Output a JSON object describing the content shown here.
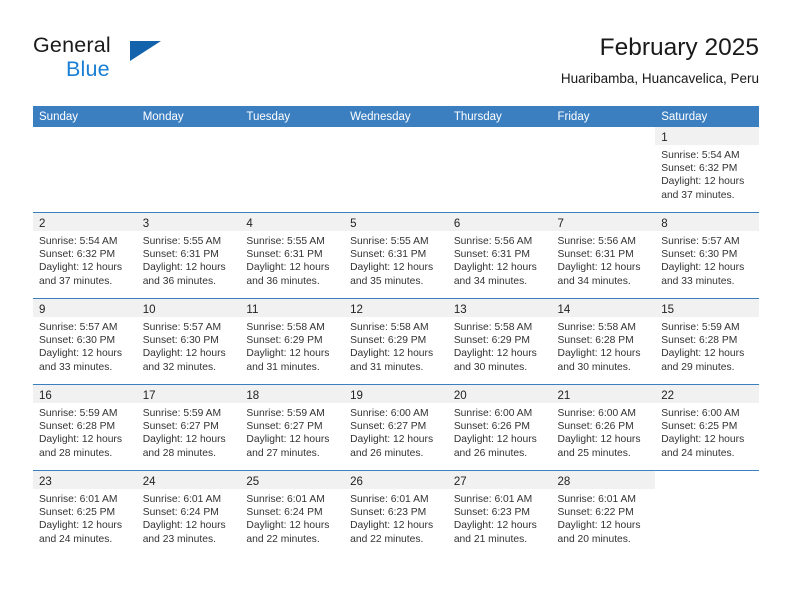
{
  "brand": {
    "line1": "General",
    "line2": "Blue",
    "triangle_color": "#1263ac",
    "blue_color": "#1a7fd4"
  },
  "header": {
    "title": "February 2025",
    "location": "Huaribamba, Huancavelica, Peru"
  },
  "theme": {
    "header_blue": "#3c7fc1",
    "date_band_gray": "#f1f1f1"
  },
  "calendar": {
    "weekday_headers": [
      "Sunday",
      "Monday",
      "Tuesday",
      "Wednesday",
      "Thursday",
      "Friday",
      "Saturday"
    ],
    "labels": {
      "sunrise": "Sunrise:",
      "sunset": "Sunset:",
      "daylight": "Daylight:"
    },
    "weeks": [
      [
        {
          "empty": true
        },
        {
          "empty": true
        },
        {
          "empty": true
        },
        {
          "empty": true
        },
        {
          "empty": true
        },
        {
          "empty": true
        },
        {
          "day": "1",
          "sunrise": "Sunrise: 5:54 AM",
          "sunset": "Sunset: 6:32 PM",
          "daylight1": "Daylight: 12 hours",
          "daylight2": "and 37 minutes."
        }
      ],
      [
        {
          "day": "2",
          "sunrise": "Sunrise: 5:54 AM",
          "sunset": "Sunset: 6:32 PM",
          "daylight1": "Daylight: 12 hours",
          "daylight2": "and 37 minutes."
        },
        {
          "day": "3",
          "sunrise": "Sunrise: 5:55 AM",
          "sunset": "Sunset: 6:31 PM",
          "daylight1": "Daylight: 12 hours",
          "daylight2": "and 36 minutes."
        },
        {
          "day": "4",
          "sunrise": "Sunrise: 5:55 AM",
          "sunset": "Sunset: 6:31 PM",
          "daylight1": "Daylight: 12 hours",
          "daylight2": "and 36 minutes."
        },
        {
          "day": "5",
          "sunrise": "Sunrise: 5:55 AM",
          "sunset": "Sunset: 6:31 PM",
          "daylight1": "Daylight: 12 hours",
          "daylight2": "and 35 minutes."
        },
        {
          "day": "6",
          "sunrise": "Sunrise: 5:56 AM",
          "sunset": "Sunset: 6:31 PM",
          "daylight1": "Daylight: 12 hours",
          "daylight2": "and 34 minutes."
        },
        {
          "day": "7",
          "sunrise": "Sunrise: 5:56 AM",
          "sunset": "Sunset: 6:31 PM",
          "daylight1": "Daylight: 12 hours",
          "daylight2": "and 34 minutes."
        },
        {
          "day": "8",
          "sunrise": "Sunrise: 5:57 AM",
          "sunset": "Sunset: 6:30 PM",
          "daylight1": "Daylight: 12 hours",
          "daylight2": "and 33 minutes."
        }
      ],
      [
        {
          "day": "9",
          "sunrise": "Sunrise: 5:57 AM",
          "sunset": "Sunset: 6:30 PM",
          "daylight1": "Daylight: 12 hours",
          "daylight2": "and 33 minutes."
        },
        {
          "day": "10",
          "sunrise": "Sunrise: 5:57 AM",
          "sunset": "Sunset: 6:30 PM",
          "daylight1": "Daylight: 12 hours",
          "daylight2": "and 32 minutes."
        },
        {
          "day": "11",
          "sunrise": "Sunrise: 5:58 AM",
          "sunset": "Sunset: 6:29 PM",
          "daylight1": "Daylight: 12 hours",
          "daylight2": "and 31 minutes."
        },
        {
          "day": "12",
          "sunrise": "Sunrise: 5:58 AM",
          "sunset": "Sunset: 6:29 PM",
          "daylight1": "Daylight: 12 hours",
          "daylight2": "and 31 minutes."
        },
        {
          "day": "13",
          "sunrise": "Sunrise: 5:58 AM",
          "sunset": "Sunset: 6:29 PM",
          "daylight1": "Daylight: 12 hours",
          "daylight2": "and 30 minutes."
        },
        {
          "day": "14",
          "sunrise": "Sunrise: 5:58 AM",
          "sunset": "Sunset: 6:28 PM",
          "daylight1": "Daylight: 12 hours",
          "daylight2": "and 30 minutes."
        },
        {
          "day": "15",
          "sunrise": "Sunrise: 5:59 AM",
          "sunset": "Sunset: 6:28 PM",
          "daylight1": "Daylight: 12 hours",
          "daylight2": "and 29 minutes."
        }
      ],
      [
        {
          "day": "16",
          "sunrise": "Sunrise: 5:59 AM",
          "sunset": "Sunset: 6:28 PM",
          "daylight1": "Daylight: 12 hours",
          "daylight2": "and 28 minutes."
        },
        {
          "day": "17",
          "sunrise": "Sunrise: 5:59 AM",
          "sunset": "Sunset: 6:27 PM",
          "daylight1": "Daylight: 12 hours",
          "daylight2": "and 28 minutes."
        },
        {
          "day": "18",
          "sunrise": "Sunrise: 5:59 AM",
          "sunset": "Sunset: 6:27 PM",
          "daylight1": "Daylight: 12 hours",
          "daylight2": "and 27 minutes."
        },
        {
          "day": "19",
          "sunrise": "Sunrise: 6:00 AM",
          "sunset": "Sunset: 6:27 PM",
          "daylight1": "Daylight: 12 hours",
          "daylight2": "and 26 minutes."
        },
        {
          "day": "20",
          "sunrise": "Sunrise: 6:00 AM",
          "sunset": "Sunset: 6:26 PM",
          "daylight1": "Daylight: 12 hours",
          "daylight2": "and 26 minutes."
        },
        {
          "day": "21",
          "sunrise": "Sunrise: 6:00 AM",
          "sunset": "Sunset: 6:26 PM",
          "daylight1": "Daylight: 12 hours",
          "daylight2": "and 25 minutes."
        },
        {
          "day": "22",
          "sunrise": "Sunrise: 6:00 AM",
          "sunset": "Sunset: 6:25 PM",
          "daylight1": "Daylight: 12 hours",
          "daylight2": "and 24 minutes."
        }
      ],
      [
        {
          "day": "23",
          "sunrise": "Sunrise: 6:01 AM",
          "sunset": "Sunset: 6:25 PM",
          "daylight1": "Daylight: 12 hours",
          "daylight2": "and 24 minutes."
        },
        {
          "day": "24",
          "sunrise": "Sunrise: 6:01 AM",
          "sunset": "Sunset: 6:24 PM",
          "daylight1": "Daylight: 12 hours",
          "daylight2": "and 23 minutes."
        },
        {
          "day": "25",
          "sunrise": "Sunrise: 6:01 AM",
          "sunset": "Sunset: 6:24 PM",
          "daylight1": "Daylight: 12 hours",
          "daylight2": "and 22 minutes."
        },
        {
          "day": "26",
          "sunrise": "Sunrise: 6:01 AM",
          "sunset": "Sunset: 6:23 PM",
          "daylight1": "Daylight: 12 hours",
          "daylight2": "and 22 minutes."
        },
        {
          "day": "27",
          "sunrise": "Sunrise: 6:01 AM",
          "sunset": "Sunset: 6:23 PM",
          "daylight1": "Daylight: 12 hours",
          "daylight2": "and 21 minutes."
        },
        {
          "day": "28",
          "sunrise": "Sunrise: 6:01 AM",
          "sunset": "Sunset: 6:22 PM",
          "daylight1": "Daylight: 12 hours",
          "daylight2": "and 20 minutes."
        },
        {
          "empty": true
        }
      ]
    ]
  }
}
